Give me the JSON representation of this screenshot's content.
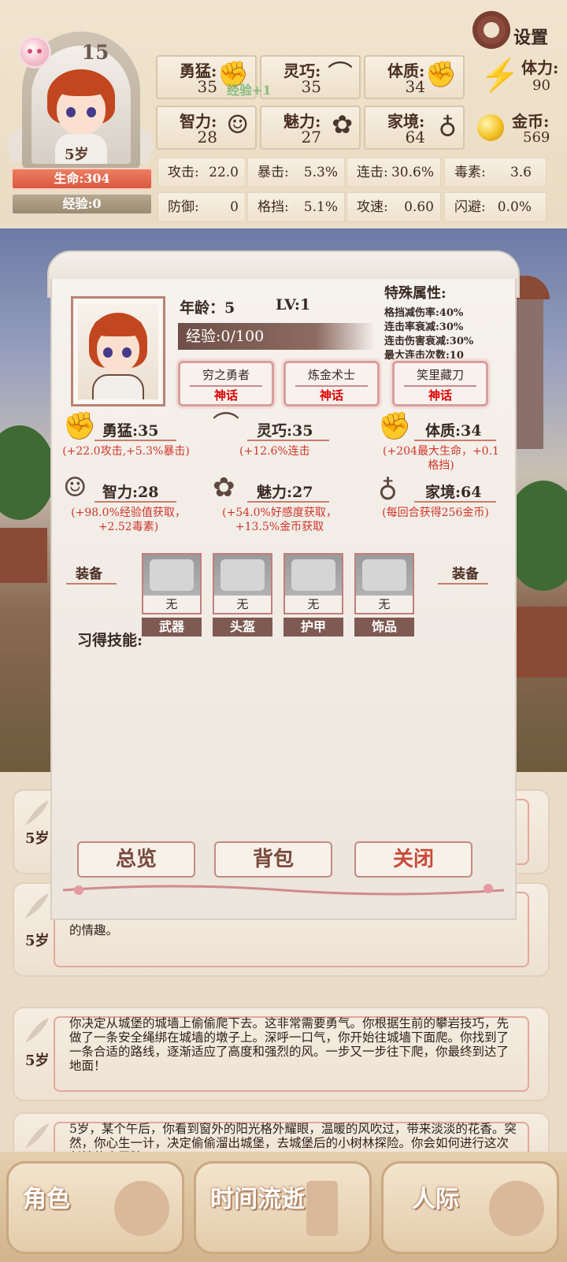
{
  "header": {
    "level": "15",
    "age_badge": "5岁",
    "hp_label": "生命:304",
    "xp_label": "经验:0",
    "float_text": "经验+1",
    "settings_label": "设置"
  },
  "attributes": [
    {
      "label": "勇猛:",
      "value": "35"
    },
    {
      "label": "灵巧:",
      "value": "35"
    },
    {
      "label": "体质:",
      "value": "34"
    },
    {
      "label": "智力:",
      "value": "28"
    },
    {
      "label": "魅力:",
      "value": "27"
    },
    {
      "label": "家境:",
      "value": "64"
    }
  ],
  "resources": {
    "stamina_label": "体力:",
    "stamina_value": "90",
    "gold_label": "金币:",
    "gold_value": "569"
  },
  "combat": [
    {
      "label": "攻击:",
      "value": "22.0"
    },
    {
      "label": "暴击:",
      "value": "5.3%"
    },
    {
      "label": "连击:",
      "value": "30.6%"
    },
    {
      "label": "毒素:",
      "value": "3.6"
    },
    {
      "label": "防御:",
      "value": "0"
    },
    {
      "label": "格挡:",
      "value": "5.1%"
    },
    {
      "label": "攻速:",
      "value": "0.60"
    },
    {
      "label": "闪避:",
      "value": "0.0%"
    }
  ],
  "dialog": {
    "age": "年龄：5",
    "level": "LV:1",
    "xp": "经验:0/100",
    "special_title": "特殊属性:",
    "special_lines": [
      "格挡减伤率:40%",
      "连击率衰减:30%",
      "连击伤害衰减:30%",
      "最大连击次数:10"
    ],
    "traits": [
      {
        "name": "穷之勇者",
        "rank": "神话"
      },
      {
        "name": "炼金术士",
        "rank": "神话"
      },
      {
        "name": "笑里藏刀",
        "rank": "神话"
      }
    ],
    "attrs": [
      {
        "head": "勇猛:35",
        "desc": "(+22.0攻击,+5.3%暴击)"
      },
      {
        "head": "灵巧:35",
        "desc": "(+12.6%连击"
      },
      {
        "head": "体质:34",
        "desc": "(+204最大生命，+0.1格挡)"
      },
      {
        "head": "智力:28",
        "desc": "(+98.0%经验值获取，+2.52毒素)"
      },
      {
        "head": "魅力:27",
        "desc": "(+54.0%好感度获取，+13.5%金币获取"
      },
      {
        "head": "家境:64",
        "desc": "(每回合获得256金币)"
      }
    ],
    "equip_label": "装备",
    "equip_slots": [
      {
        "state": "无",
        "name": "武器"
      },
      {
        "state": "无",
        "name": "头盔"
      },
      {
        "state": "无",
        "name": "护甲"
      },
      {
        "state": "无",
        "name": "饰品"
      }
    ],
    "skills_label": "习得技能:",
    "buttons": {
      "overview": "总览",
      "bag": "背包",
      "close": "关闭"
    }
  },
  "logs": [
    {
      "age": "5岁",
      "text": ""
    },
    {
      "age": "5岁",
      "text": "的情趣。"
    },
    {
      "age": "5岁",
      "text": "你决定从城堡的城墙上偷偷爬下去。这非常需要勇气。你根据生前的攀岩技巧，先做了一条安全绳绑在城墙的墩子上。深呼一口气，你开始往城墙下面爬。你找到了一条合适的路线，逐渐适应了高度和强烈的风。一步又一步往下爬，你最终到达了地面！"
    },
    {
      "age": "5岁",
      "text": "5岁，某个午后，你看到窗外的阳光格外耀眼，温暖的风吹过，带来淡淡的花香。突然，你心生一计，决定偷偷溜出城堡，去城堡后的小树林探险。你会如何进行这次任性的小冒险？"
    }
  ],
  "nav": {
    "role": "角色",
    "time": "时间流逝",
    "social": "人际"
  }
}
